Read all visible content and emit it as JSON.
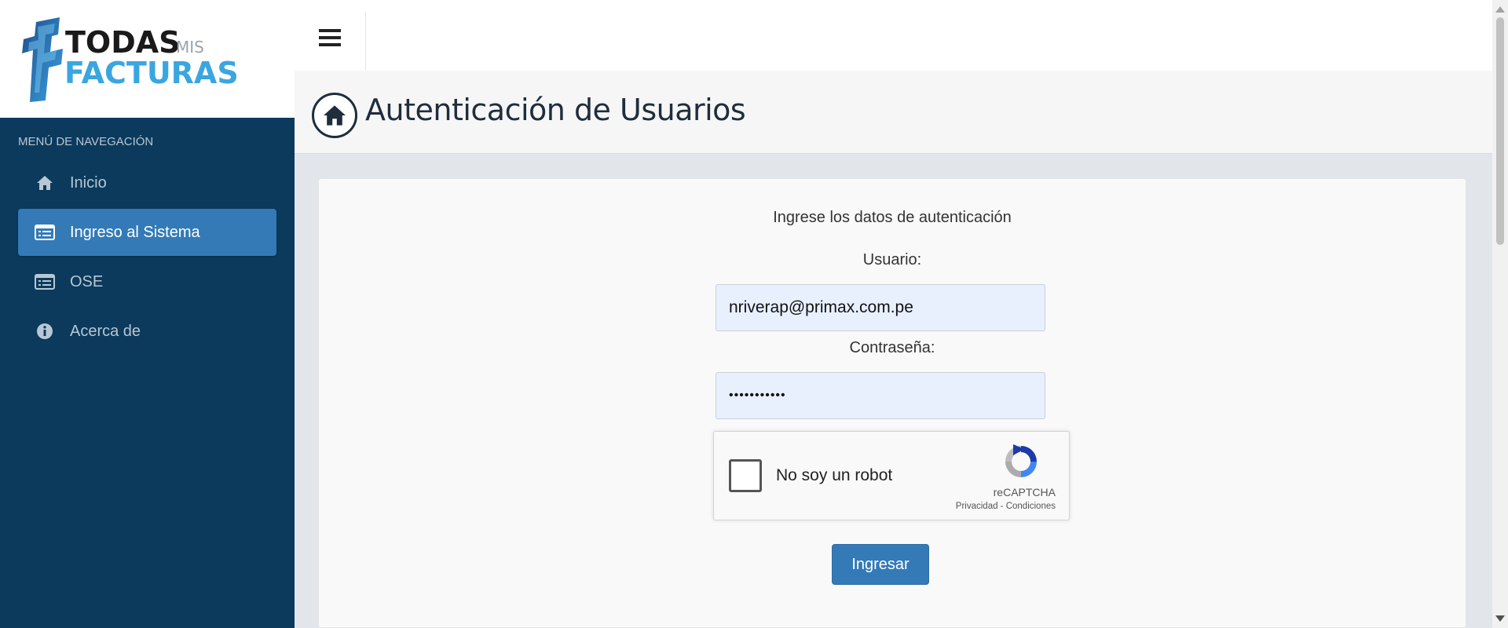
{
  "brand": {
    "todas": "TODAS",
    "mis": "MIS",
    "facturas": "FACTURAS",
    "f_letter": "F"
  },
  "sidebar": {
    "header": "MENÚ DE NAVEGACIÓN",
    "items": [
      {
        "label": "Inicio",
        "icon": "home-icon",
        "active": false
      },
      {
        "label": "Ingreso al Sistema",
        "icon": "list-icon",
        "active": true
      },
      {
        "label": "OSE",
        "icon": "list-icon",
        "active": false
      },
      {
        "label": "Acerca de",
        "icon": "info-circle-icon",
        "active": false
      }
    ]
  },
  "topbar": {
    "menu_icon": "hamburger-icon"
  },
  "page": {
    "title": "Autenticación de Usuarios",
    "title_icon": "home-icon"
  },
  "form": {
    "intro": "Ingrese los datos de autenticación",
    "user_label": "Usuario:",
    "user_value": "nriverap@primax.com.pe",
    "password_label": "Contraseña:",
    "password_value": "•••••••••••",
    "submit_label": "Ingresar"
  },
  "recaptcha": {
    "checkbox_text": "No soy un robot",
    "brand": "reCAPTCHA",
    "links": "Privacidad - Condiciones"
  },
  "colors": {
    "sidebar_bg": "#0b3a5c",
    "active_item": "#337ab7",
    "button": "#337ab7",
    "input_bg": "#e8f0fe"
  }
}
